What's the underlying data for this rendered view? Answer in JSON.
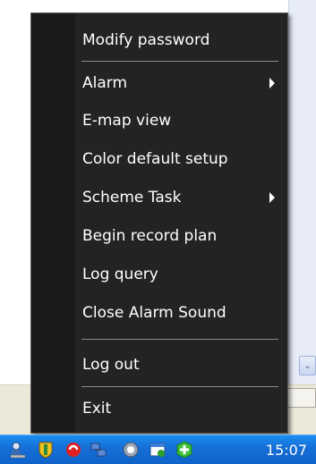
{
  "menu": {
    "items": [
      {
        "label": "Modify password",
        "has_submenu": false
      },
      {
        "label": "Alarm",
        "has_submenu": true
      },
      {
        "label": "E-map view",
        "has_submenu": false
      },
      {
        "label": "Color default setup",
        "has_submenu": false
      },
      {
        "label": "Scheme Task",
        "has_submenu": true
      },
      {
        "label": "Begin record plan",
        "has_submenu": false
      },
      {
        "label": "Log query",
        "has_submenu": false
      },
      {
        "label": "Close Alarm Sound",
        "has_submenu": false
      },
      {
        "label": "Log out",
        "has_submenu": false
      },
      {
        "label": "Exit",
        "has_submenu": false
      }
    ],
    "colors": {
      "background": "#232323",
      "text": "#ffffff"
    }
  },
  "tray": {
    "icons": [
      "network-users-icon",
      "shield-icon",
      "red-swirl-icon",
      "network-connection-icon",
      "volume-icon",
      "calendar-task-icon",
      "green-plus-icon"
    ],
    "clock": "15:07"
  }
}
